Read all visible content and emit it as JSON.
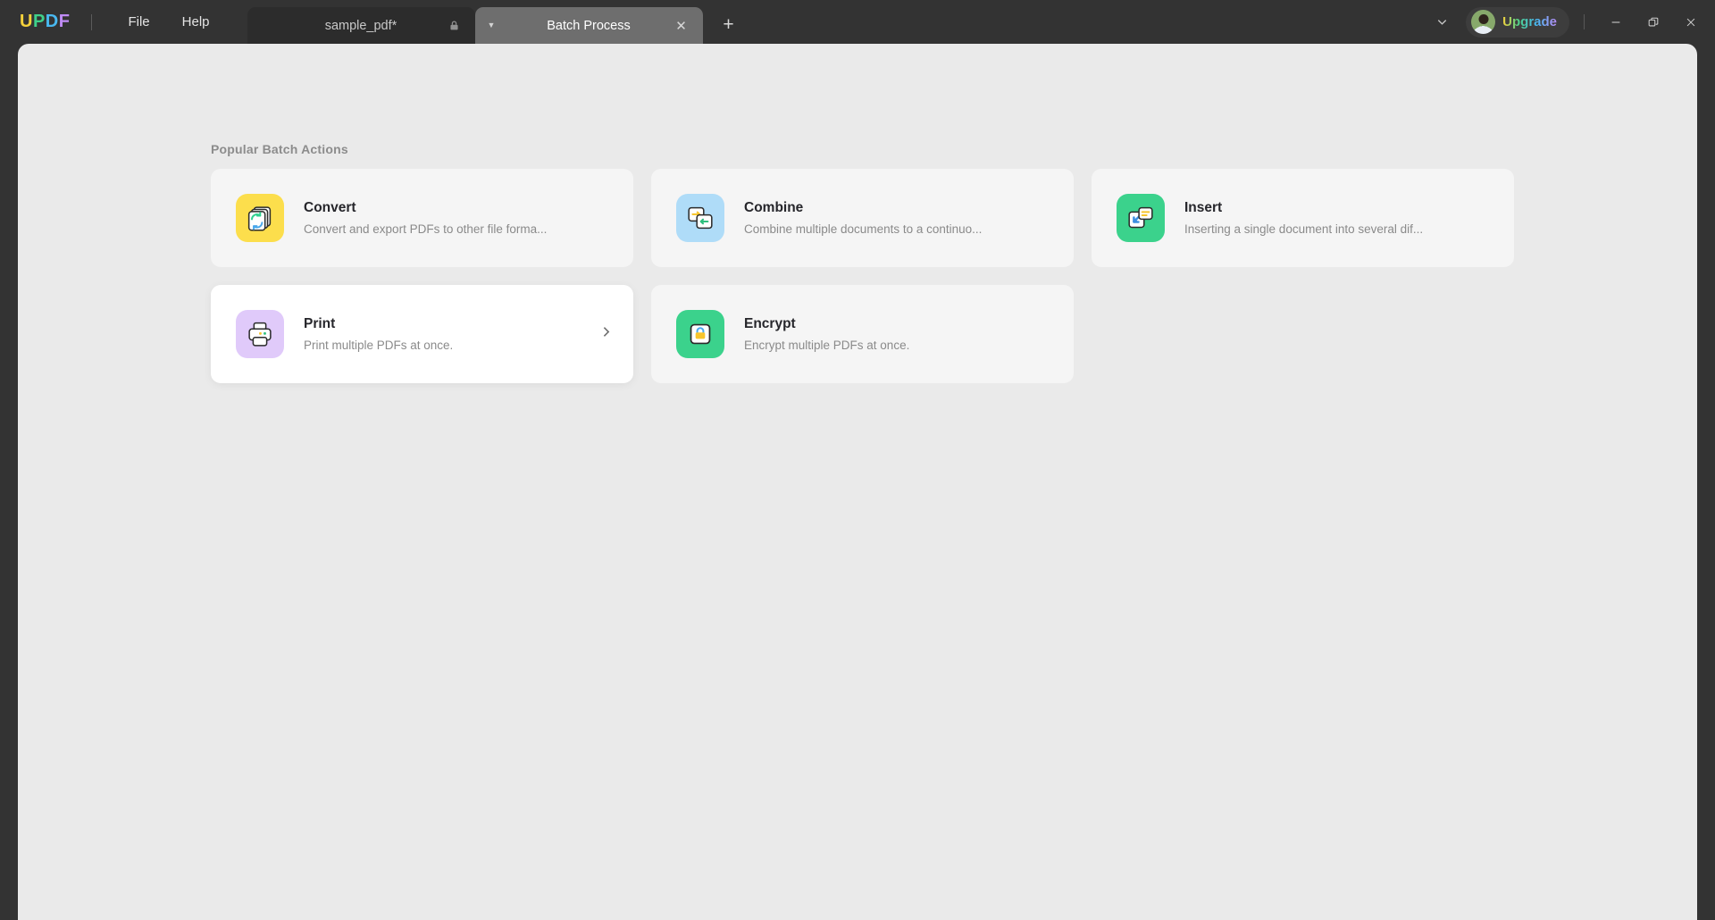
{
  "window": {
    "logo": {
      "letters": [
        "U",
        "P",
        "D",
        "F"
      ]
    },
    "menus": [
      {
        "id": "file",
        "label": "File"
      },
      {
        "id": "help",
        "label": "Help"
      }
    ],
    "tabs": [
      {
        "id": "sample-pdf",
        "label": "sample_pdf*",
        "active": false,
        "locked": true
      },
      {
        "id": "batch-process",
        "label": "Batch Process",
        "active": true,
        "locked": false
      }
    ],
    "new_tab_label": "+",
    "upgrade_label": "Upgrade",
    "controls": {
      "minimize": "—",
      "restore": "❐",
      "close": "✕"
    }
  },
  "main": {
    "section_title": "Popular Batch Actions",
    "cards": [
      {
        "id": "convert",
        "title": "Convert",
        "description": "Convert and export PDFs to other file forma...",
        "icon": "convert-icon",
        "icon_bg": "#FCDE4C",
        "hovered": false
      },
      {
        "id": "combine",
        "title": "Combine",
        "description": "Combine multiple documents to a continuo...",
        "icon": "combine-icon",
        "icon_bg": "#AFDCF8",
        "hovered": false
      },
      {
        "id": "insert",
        "title": "Insert",
        "description": "Inserting a single document into several dif...",
        "icon": "insert-icon",
        "icon_bg": "#3BD28C",
        "hovered": false
      },
      {
        "id": "print",
        "title": "Print",
        "description": "Print multiple PDFs at once.",
        "icon": "print-icon",
        "icon_bg": "#E0CAFA",
        "hovered": true
      },
      {
        "id": "encrypt",
        "title": "Encrypt",
        "description": "Encrypt multiple PDFs at once.",
        "icon": "encrypt-icon",
        "icon_bg": "#3BD28C",
        "hovered": false
      }
    ]
  }
}
